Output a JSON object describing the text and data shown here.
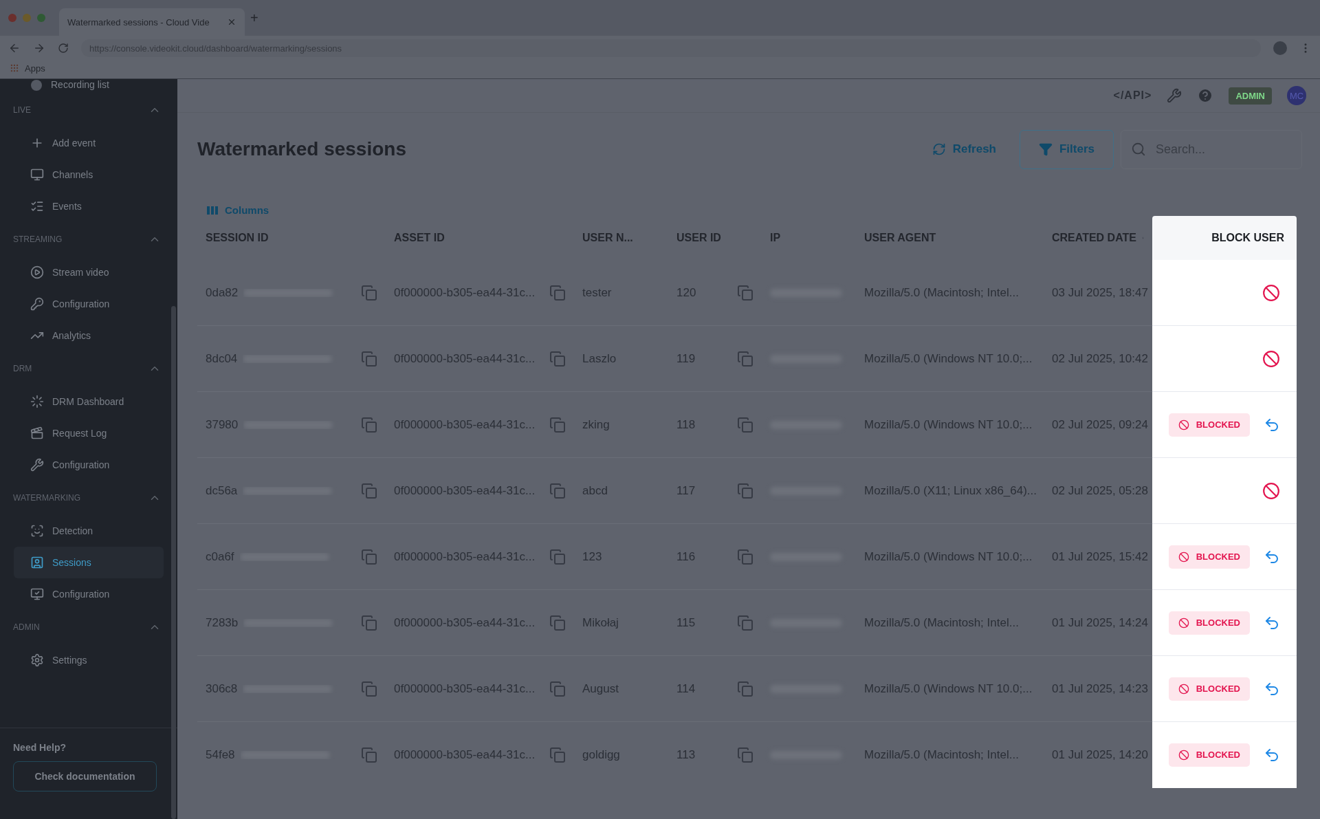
{
  "browser": {
    "tab_title": "Watermarked sessions - Cloud Vide",
    "new_tab": "+",
    "url": "https://console.videokit.cloud/dashboard/watermarking/sessions",
    "bookmark": "Apps"
  },
  "sidebar": {
    "top_item": {
      "label": "Recording list"
    },
    "sections": [
      {
        "title": "LIVE",
        "expanded": true,
        "items": [
          {
            "label": "Add event",
            "selected": false
          },
          {
            "label": "Channels",
            "selected": false
          },
          {
            "label": "Events",
            "selected": false
          }
        ]
      },
      {
        "title": "STREAMING",
        "expanded": true,
        "items": [
          {
            "label": "Stream video",
            "selected": false
          },
          {
            "label": "Configuration",
            "selected": false
          },
          {
            "label": "Analytics",
            "selected": false
          }
        ]
      },
      {
        "title": "DRM",
        "expanded": true,
        "items": [
          {
            "label": "DRM Dashboard",
            "selected": false
          },
          {
            "label": "Request Log",
            "selected": false
          },
          {
            "label": "Configuration",
            "selected": false
          }
        ]
      },
      {
        "title": "WATERMARKING",
        "expanded": true,
        "items": [
          {
            "label": "Detection",
            "selected": false
          },
          {
            "label": "Sessions",
            "selected": true
          },
          {
            "label": "Configuration",
            "selected": false
          }
        ]
      },
      {
        "title": "ADMIN",
        "expanded": true,
        "items": [
          {
            "label": "Settings",
            "selected": false
          }
        ]
      }
    ],
    "help_title": "Need Help?",
    "help_button": "Check documentation"
  },
  "topbar": {
    "api_link": "</API>",
    "role_badge": "ADMIN",
    "avatar": "MC"
  },
  "page": {
    "title": "Watermarked sessions",
    "refresh": "Refresh",
    "filters": "Filters",
    "search": {
      "placeholder": "Search..."
    },
    "columns_button": "Columns"
  },
  "table": {
    "columns": [
      "SESSION ID",
      "ASSET ID",
      "USER N...",
      "USER ID",
      "IP",
      "USER AGENT",
      "CREATED DATE",
      "BLOCK USER"
    ],
    "rows": [
      {
        "session_id": "0da82",
        "asset_id": "0f000000-b305-ea44-31c...",
        "user_name": "tester",
        "user_id": "120",
        "user_agent": "Mozilla/5.0 (Macintosh; Intel...",
        "created": "03 Jul 2025, 18:47",
        "blocked": false
      },
      {
        "session_id": "8dc04",
        "asset_id": "0f000000-b305-ea44-31c...",
        "user_name": "Laszlo",
        "user_id": "119",
        "user_agent": "Mozilla/5.0 (Windows NT 10.0;...",
        "created": "02 Jul 2025, 10:42",
        "blocked": false
      },
      {
        "session_id": "37980",
        "asset_id": "0f000000-b305-ea44-31c...",
        "user_name": "zking",
        "user_id": "118",
        "user_agent": "Mozilla/5.0 (Windows NT 10.0;...",
        "created": "02 Jul 2025, 09:24",
        "blocked": true,
        "badge": "BLOCKED"
      },
      {
        "session_id": "dc56a",
        "asset_id": "0f000000-b305-ea44-31c...",
        "user_name": "abcd",
        "user_id": "117",
        "user_agent": "Mozilla/5.0 (X11; Linux x86_64)...",
        "created": "02 Jul 2025, 05:28",
        "blocked": false
      },
      {
        "session_id": "c0a6f",
        "asset_id": "0f000000-b305-ea44-31c...",
        "user_name": "123",
        "user_id": "116",
        "user_agent": "Mozilla/5.0 (Windows NT 10.0;...",
        "created": "01 Jul 2025, 15:42",
        "blocked": true,
        "badge": "BLOCKED"
      },
      {
        "session_id": "7283b",
        "asset_id": "0f000000-b305-ea44-31c...",
        "user_name": "Mikołaj",
        "user_id": "115",
        "user_agent": "Mozilla/5.0 (Macintosh; Intel...",
        "created": "01 Jul 2025, 14:24",
        "blocked": true,
        "badge": "BLOCKED"
      },
      {
        "session_id": "306c8",
        "asset_id": "0f000000-b305-ea44-31c...",
        "user_name": "August",
        "user_id": "114",
        "user_agent": "Mozilla/5.0 (Windows NT 10.0;...",
        "created": "01 Jul 2025, 14:23",
        "blocked": true,
        "badge": "BLOCKED"
      },
      {
        "session_id": "54fe8",
        "asset_id": "0f000000-b305-ea44-31c...",
        "user_name": "goldigg",
        "user_id": "113",
        "user_agent": "Mozilla/5.0 (Macintosh; Intel...",
        "created": "01 Jul 2025, 14:20",
        "blocked": true,
        "badge": "BLOCKED"
      }
    ]
  }
}
